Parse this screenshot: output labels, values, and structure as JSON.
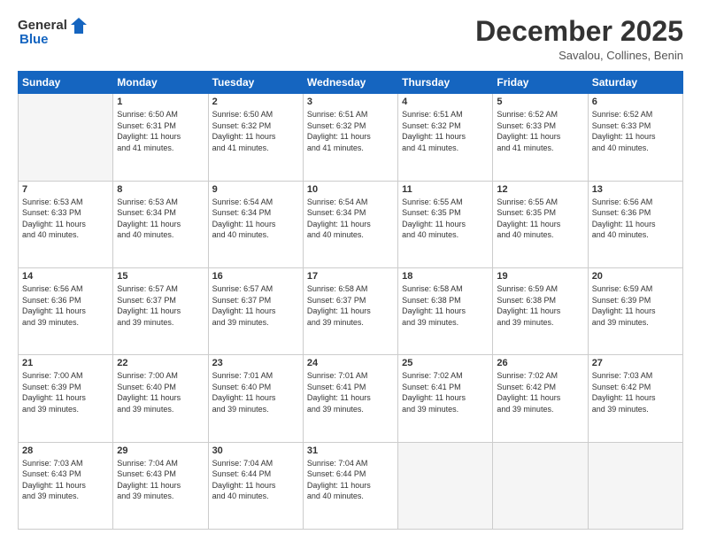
{
  "logo": {
    "general": "General",
    "blue": "Blue"
  },
  "title": "December 2025",
  "location": "Savalou, Collines, Benin",
  "days_of_week": [
    "Sunday",
    "Monday",
    "Tuesday",
    "Wednesday",
    "Thursday",
    "Friday",
    "Saturday"
  ],
  "weeks": [
    [
      {
        "day": "",
        "empty": true
      },
      {
        "day": "1",
        "sunrise": "6:50 AM",
        "sunset": "6:31 PM",
        "daylight": "11 hours and 41 minutes."
      },
      {
        "day": "2",
        "sunrise": "6:50 AM",
        "sunset": "6:32 PM",
        "daylight": "11 hours and 41 minutes."
      },
      {
        "day": "3",
        "sunrise": "6:51 AM",
        "sunset": "6:32 PM",
        "daylight": "11 hours and 41 minutes."
      },
      {
        "day": "4",
        "sunrise": "6:51 AM",
        "sunset": "6:32 PM",
        "daylight": "11 hours and 41 minutes."
      },
      {
        "day": "5",
        "sunrise": "6:52 AM",
        "sunset": "6:33 PM",
        "daylight": "11 hours and 41 minutes."
      },
      {
        "day": "6",
        "sunrise": "6:52 AM",
        "sunset": "6:33 PM",
        "daylight": "11 hours and 40 minutes."
      }
    ],
    [
      {
        "day": "7",
        "sunrise": "6:53 AM",
        "sunset": "6:33 PM",
        "daylight": "11 hours and 40 minutes."
      },
      {
        "day": "8",
        "sunrise": "6:53 AM",
        "sunset": "6:34 PM",
        "daylight": "11 hours and 40 minutes."
      },
      {
        "day": "9",
        "sunrise": "6:54 AM",
        "sunset": "6:34 PM",
        "daylight": "11 hours and 40 minutes."
      },
      {
        "day": "10",
        "sunrise": "6:54 AM",
        "sunset": "6:34 PM",
        "daylight": "11 hours and 40 minutes."
      },
      {
        "day": "11",
        "sunrise": "6:55 AM",
        "sunset": "6:35 PM",
        "daylight": "11 hours and 40 minutes."
      },
      {
        "day": "12",
        "sunrise": "6:55 AM",
        "sunset": "6:35 PM",
        "daylight": "11 hours and 40 minutes."
      },
      {
        "day": "13",
        "sunrise": "6:56 AM",
        "sunset": "6:36 PM",
        "daylight": "11 hours and 40 minutes."
      }
    ],
    [
      {
        "day": "14",
        "sunrise": "6:56 AM",
        "sunset": "6:36 PM",
        "daylight": "11 hours and 39 minutes."
      },
      {
        "day": "15",
        "sunrise": "6:57 AM",
        "sunset": "6:37 PM",
        "daylight": "11 hours and 39 minutes."
      },
      {
        "day": "16",
        "sunrise": "6:57 AM",
        "sunset": "6:37 PM",
        "daylight": "11 hours and 39 minutes."
      },
      {
        "day": "17",
        "sunrise": "6:58 AM",
        "sunset": "6:37 PM",
        "daylight": "11 hours and 39 minutes."
      },
      {
        "day": "18",
        "sunrise": "6:58 AM",
        "sunset": "6:38 PM",
        "daylight": "11 hours and 39 minutes."
      },
      {
        "day": "19",
        "sunrise": "6:59 AM",
        "sunset": "6:38 PM",
        "daylight": "11 hours and 39 minutes."
      },
      {
        "day": "20",
        "sunrise": "6:59 AM",
        "sunset": "6:39 PM",
        "daylight": "11 hours and 39 minutes."
      }
    ],
    [
      {
        "day": "21",
        "sunrise": "7:00 AM",
        "sunset": "6:39 PM",
        "daylight": "11 hours and 39 minutes."
      },
      {
        "day": "22",
        "sunrise": "7:00 AM",
        "sunset": "6:40 PM",
        "daylight": "11 hours and 39 minutes."
      },
      {
        "day": "23",
        "sunrise": "7:01 AM",
        "sunset": "6:40 PM",
        "daylight": "11 hours and 39 minutes."
      },
      {
        "day": "24",
        "sunrise": "7:01 AM",
        "sunset": "6:41 PM",
        "daylight": "11 hours and 39 minutes."
      },
      {
        "day": "25",
        "sunrise": "7:02 AM",
        "sunset": "6:41 PM",
        "daylight": "11 hours and 39 minutes."
      },
      {
        "day": "26",
        "sunrise": "7:02 AM",
        "sunset": "6:42 PM",
        "daylight": "11 hours and 39 minutes."
      },
      {
        "day": "27",
        "sunrise": "7:03 AM",
        "sunset": "6:42 PM",
        "daylight": "11 hours and 39 minutes."
      }
    ],
    [
      {
        "day": "28",
        "sunrise": "7:03 AM",
        "sunset": "6:43 PM",
        "daylight": "11 hours and 39 minutes."
      },
      {
        "day": "29",
        "sunrise": "7:04 AM",
        "sunset": "6:43 PM",
        "daylight": "11 hours and 39 minutes."
      },
      {
        "day": "30",
        "sunrise": "7:04 AM",
        "sunset": "6:44 PM",
        "daylight": "11 hours and 40 minutes."
      },
      {
        "day": "31",
        "sunrise": "7:04 AM",
        "sunset": "6:44 PM",
        "daylight": "11 hours and 40 minutes."
      },
      {
        "day": "",
        "empty": true
      },
      {
        "day": "",
        "empty": true
      },
      {
        "day": "",
        "empty": true
      }
    ]
  ]
}
